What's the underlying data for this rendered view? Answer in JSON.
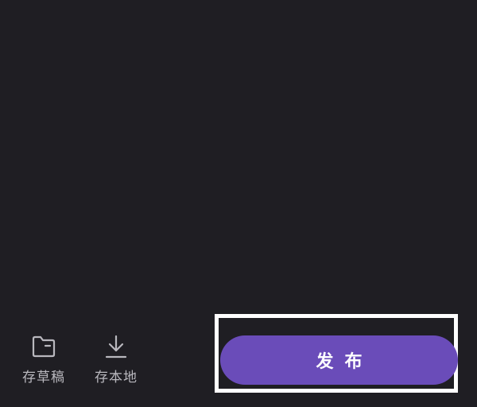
{
  "bottom_bar": {
    "save_draft": {
      "label": "存草稿",
      "icon": "folder-icon"
    },
    "save_local": {
      "label": "存本地",
      "icon": "download-icon"
    },
    "publish": {
      "label": "发布",
      "color": "#6a4cb9"
    }
  },
  "colors": {
    "background": "#1f1e23",
    "label_text": "#b9b8be",
    "highlight_border": "#ffffff"
  }
}
